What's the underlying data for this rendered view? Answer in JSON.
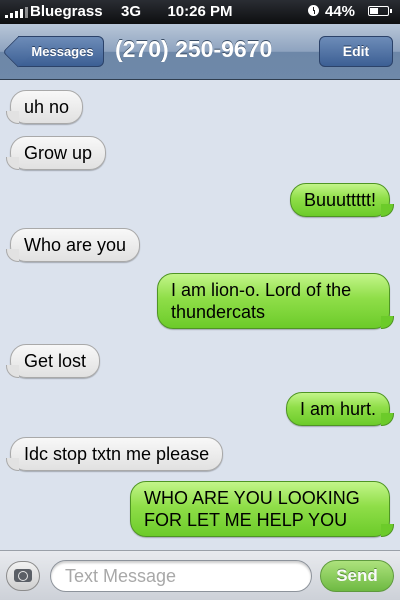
{
  "status_bar": {
    "carrier": "Bluegrass",
    "network": "3G",
    "time": "10:26 PM",
    "battery": "44%",
    "icons": [
      "signal-icon",
      "alarm-icon",
      "battery-icon"
    ]
  },
  "nav": {
    "back_label": "Messages",
    "title": "(270) 250-9670",
    "edit_label": "Edit"
  },
  "messages": [
    {
      "direction": "incoming",
      "text": "uh no"
    },
    {
      "direction": "incoming",
      "text": "Grow up"
    },
    {
      "direction": "outgoing",
      "text": "Buuuttttt!"
    },
    {
      "direction": "incoming",
      "text": "Who are you"
    },
    {
      "direction": "outgoing",
      "text": "I am lion-o. Lord of the thundercats"
    },
    {
      "direction": "incoming",
      "text": "Get lost"
    },
    {
      "direction": "outgoing",
      "text": "I am hurt."
    },
    {
      "direction": "incoming",
      "text": "Idc stop txtn me please"
    },
    {
      "direction": "outgoing",
      "text": "WHO ARE YOU LOOKING FOR LET ME HELP YOU"
    }
  ],
  "composer": {
    "placeholder": "Text Message",
    "value": "",
    "send_label": "Send"
  },
  "colors": {
    "incoming_bubble": "#e6e6e6",
    "outgoing_bubble": "#8fde48",
    "nav_bar": "#8ea3bf",
    "background": "#dbe2ed"
  }
}
